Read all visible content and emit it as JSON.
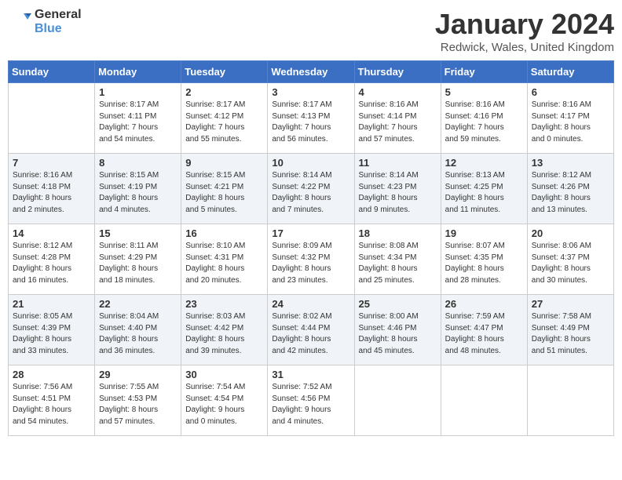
{
  "header": {
    "logo_general": "General",
    "logo_blue": "Blue",
    "month_year": "January 2024",
    "location": "Redwick, Wales, United Kingdom"
  },
  "weekdays": [
    "Sunday",
    "Monday",
    "Tuesday",
    "Wednesday",
    "Thursday",
    "Friday",
    "Saturday"
  ],
  "weeks": [
    [
      {
        "day": "",
        "info": ""
      },
      {
        "day": "1",
        "info": "Sunrise: 8:17 AM\nSunset: 4:11 PM\nDaylight: 7 hours\nand 54 minutes."
      },
      {
        "day": "2",
        "info": "Sunrise: 8:17 AM\nSunset: 4:12 PM\nDaylight: 7 hours\nand 55 minutes."
      },
      {
        "day": "3",
        "info": "Sunrise: 8:17 AM\nSunset: 4:13 PM\nDaylight: 7 hours\nand 56 minutes."
      },
      {
        "day": "4",
        "info": "Sunrise: 8:16 AM\nSunset: 4:14 PM\nDaylight: 7 hours\nand 57 minutes."
      },
      {
        "day": "5",
        "info": "Sunrise: 8:16 AM\nSunset: 4:16 PM\nDaylight: 7 hours\nand 59 minutes."
      },
      {
        "day": "6",
        "info": "Sunrise: 8:16 AM\nSunset: 4:17 PM\nDaylight: 8 hours\nand 0 minutes."
      }
    ],
    [
      {
        "day": "7",
        "info": "Sunrise: 8:16 AM\nSunset: 4:18 PM\nDaylight: 8 hours\nand 2 minutes."
      },
      {
        "day": "8",
        "info": "Sunrise: 8:15 AM\nSunset: 4:19 PM\nDaylight: 8 hours\nand 4 minutes."
      },
      {
        "day": "9",
        "info": "Sunrise: 8:15 AM\nSunset: 4:21 PM\nDaylight: 8 hours\nand 5 minutes."
      },
      {
        "day": "10",
        "info": "Sunrise: 8:14 AM\nSunset: 4:22 PM\nDaylight: 8 hours\nand 7 minutes."
      },
      {
        "day": "11",
        "info": "Sunrise: 8:14 AM\nSunset: 4:23 PM\nDaylight: 8 hours\nand 9 minutes."
      },
      {
        "day": "12",
        "info": "Sunrise: 8:13 AM\nSunset: 4:25 PM\nDaylight: 8 hours\nand 11 minutes."
      },
      {
        "day": "13",
        "info": "Sunrise: 8:12 AM\nSunset: 4:26 PM\nDaylight: 8 hours\nand 13 minutes."
      }
    ],
    [
      {
        "day": "14",
        "info": "Sunrise: 8:12 AM\nSunset: 4:28 PM\nDaylight: 8 hours\nand 16 minutes."
      },
      {
        "day": "15",
        "info": "Sunrise: 8:11 AM\nSunset: 4:29 PM\nDaylight: 8 hours\nand 18 minutes."
      },
      {
        "day": "16",
        "info": "Sunrise: 8:10 AM\nSunset: 4:31 PM\nDaylight: 8 hours\nand 20 minutes."
      },
      {
        "day": "17",
        "info": "Sunrise: 8:09 AM\nSunset: 4:32 PM\nDaylight: 8 hours\nand 23 minutes."
      },
      {
        "day": "18",
        "info": "Sunrise: 8:08 AM\nSunset: 4:34 PM\nDaylight: 8 hours\nand 25 minutes."
      },
      {
        "day": "19",
        "info": "Sunrise: 8:07 AM\nSunset: 4:35 PM\nDaylight: 8 hours\nand 28 minutes."
      },
      {
        "day": "20",
        "info": "Sunrise: 8:06 AM\nSunset: 4:37 PM\nDaylight: 8 hours\nand 30 minutes."
      }
    ],
    [
      {
        "day": "21",
        "info": "Sunrise: 8:05 AM\nSunset: 4:39 PM\nDaylight: 8 hours\nand 33 minutes."
      },
      {
        "day": "22",
        "info": "Sunrise: 8:04 AM\nSunset: 4:40 PM\nDaylight: 8 hours\nand 36 minutes."
      },
      {
        "day": "23",
        "info": "Sunrise: 8:03 AM\nSunset: 4:42 PM\nDaylight: 8 hours\nand 39 minutes."
      },
      {
        "day": "24",
        "info": "Sunrise: 8:02 AM\nSunset: 4:44 PM\nDaylight: 8 hours\nand 42 minutes."
      },
      {
        "day": "25",
        "info": "Sunrise: 8:00 AM\nSunset: 4:46 PM\nDaylight: 8 hours\nand 45 minutes."
      },
      {
        "day": "26",
        "info": "Sunrise: 7:59 AM\nSunset: 4:47 PM\nDaylight: 8 hours\nand 48 minutes."
      },
      {
        "day": "27",
        "info": "Sunrise: 7:58 AM\nSunset: 4:49 PM\nDaylight: 8 hours\nand 51 minutes."
      }
    ],
    [
      {
        "day": "28",
        "info": "Sunrise: 7:56 AM\nSunset: 4:51 PM\nDaylight: 8 hours\nand 54 minutes."
      },
      {
        "day": "29",
        "info": "Sunrise: 7:55 AM\nSunset: 4:53 PM\nDaylight: 8 hours\nand 57 minutes."
      },
      {
        "day": "30",
        "info": "Sunrise: 7:54 AM\nSunset: 4:54 PM\nDaylight: 9 hours\nand 0 minutes."
      },
      {
        "day": "31",
        "info": "Sunrise: 7:52 AM\nSunset: 4:56 PM\nDaylight: 9 hours\nand 4 minutes."
      },
      {
        "day": "",
        "info": ""
      },
      {
        "day": "",
        "info": ""
      },
      {
        "day": "",
        "info": ""
      }
    ]
  ]
}
